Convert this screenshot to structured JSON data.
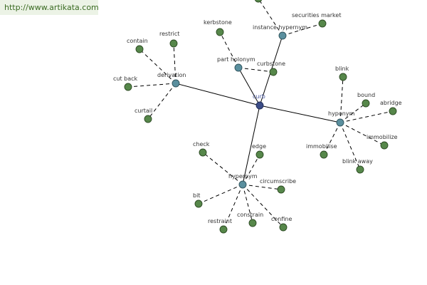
{
  "header": {
    "url": "http://www.artikata.com"
  },
  "graph": {
    "nodes": [
      {
        "id": "curb",
        "label": "curb",
        "kind": "root"
      },
      {
        "id": "derivation",
        "label": "derivation",
        "kind": "relation"
      },
      {
        "id": "part_holonym",
        "label": "part holonym",
        "kind": "relation"
      },
      {
        "id": "instance_hypernym",
        "label": "instance hypernym",
        "kind": "relation"
      },
      {
        "id": "hyponym",
        "label": "hyponym",
        "kind": "relation"
      },
      {
        "id": "hypernym",
        "label": "hypernym",
        "kind": "relation"
      },
      {
        "id": "restrict",
        "label": "restrict",
        "kind": "word"
      },
      {
        "id": "contain",
        "label": "contain",
        "kind": "word"
      },
      {
        "id": "cut_back",
        "label": "cut back",
        "kind": "word"
      },
      {
        "id": "curtail",
        "label": "curtail",
        "kind": "word"
      },
      {
        "id": "kerbstone",
        "label": "kerbstone",
        "kind": "word"
      },
      {
        "id": "curbstone",
        "label": "curbstone",
        "kind": "word"
      },
      {
        "id": "securities_market",
        "label": "securities market",
        "kind": "word"
      },
      {
        "id": "blink",
        "label": "blink",
        "kind": "word"
      },
      {
        "id": "bound",
        "label": "bound",
        "kind": "word"
      },
      {
        "id": "abridge",
        "label": "abridge",
        "kind": "word"
      },
      {
        "id": "immobilize",
        "label": "immobilize",
        "kind": "word"
      },
      {
        "id": "immobilise",
        "label": "immobilise",
        "kind": "word"
      },
      {
        "id": "blink_away",
        "label": "blink away",
        "kind": "word"
      },
      {
        "id": "check",
        "label": "check",
        "kind": "word"
      },
      {
        "id": "edge",
        "label": "edge",
        "kind": "word"
      },
      {
        "id": "circumscribe",
        "label": "circumscribe",
        "kind": "word"
      },
      {
        "id": "bit",
        "label": "bit",
        "kind": "word"
      },
      {
        "id": "restraint",
        "label": "restraint",
        "kind": "word"
      },
      {
        "id": "constrain",
        "label": "constrain",
        "kind": "word"
      },
      {
        "id": "confine",
        "label": "confine",
        "kind": "word"
      },
      {
        "id": "offscreen_top",
        "label": "",
        "kind": "word"
      }
    ],
    "edges": [
      {
        "from": "curb",
        "to": "derivation",
        "style": "solid"
      },
      {
        "from": "curb",
        "to": "part_holonym",
        "style": "solid"
      },
      {
        "from": "curb",
        "to": "instance_hypernym",
        "style": "solid"
      },
      {
        "from": "curb",
        "to": "hyponym",
        "style": "solid"
      },
      {
        "from": "curb",
        "to": "hypernym",
        "style": "solid"
      },
      {
        "from": "derivation",
        "to": "restrict",
        "style": "dashed"
      },
      {
        "from": "derivation",
        "to": "contain",
        "style": "dashed"
      },
      {
        "from": "derivation",
        "to": "cut_back",
        "style": "dashed"
      },
      {
        "from": "derivation",
        "to": "curtail",
        "style": "dashed"
      },
      {
        "from": "part_holonym",
        "to": "kerbstone",
        "style": "dashed"
      },
      {
        "from": "part_holonym",
        "to": "curbstone",
        "style": "dashed"
      },
      {
        "from": "instance_hypernym",
        "to": "securities_market",
        "style": "dashed"
      },
      {
        "from": "instance_hypernym",
        "to": "offscreen_top",
        "style": "dashed"
      },
      {
        "from": "hyponym",
        "to": "blink",
        "style": "dashed"
      },
      {
        "from": "hyponym",
        "to": "bound",
        "style": "dashed"
      },
      {
        "from": "hyponym",
        "to": "abridge",
        "style": "dashed"
      },
      {
        "from": "hyponym",
        "to": "immobilize",
        "style": "dashed"
      },
      {
        "from": "hyponym",
        "to": "immobilise",
        "style": "dashed"
      },
      {
        "from": "hyponym",
        "to": "blink_away",
        "style": "dashed"
      },
      {
        "from": "hypernym",
        "to": "check",
        "style": "dashed"
      },
      {
        "from": "hypernym",
        "to": "edge",
        "style": "dashed"
      },
      {
        "from": "hypernym",
        "to": "circumscribe",
        "style": "dashed"
      },
      {
        "from": "hypernym",
        "to": "bit",
        "style": "dashed"
      },
      {
        "from": "hypernym",
        "to": "restraint",
        "style": "dashed"
      },
      {
        "from": "hypernym",
        "to": "constrain",
        "style": "dashed"
      },
      {
        "from": "hypernym",
        "to": "confine",
        "style": "dashed"
      }
    ]
  }
}
